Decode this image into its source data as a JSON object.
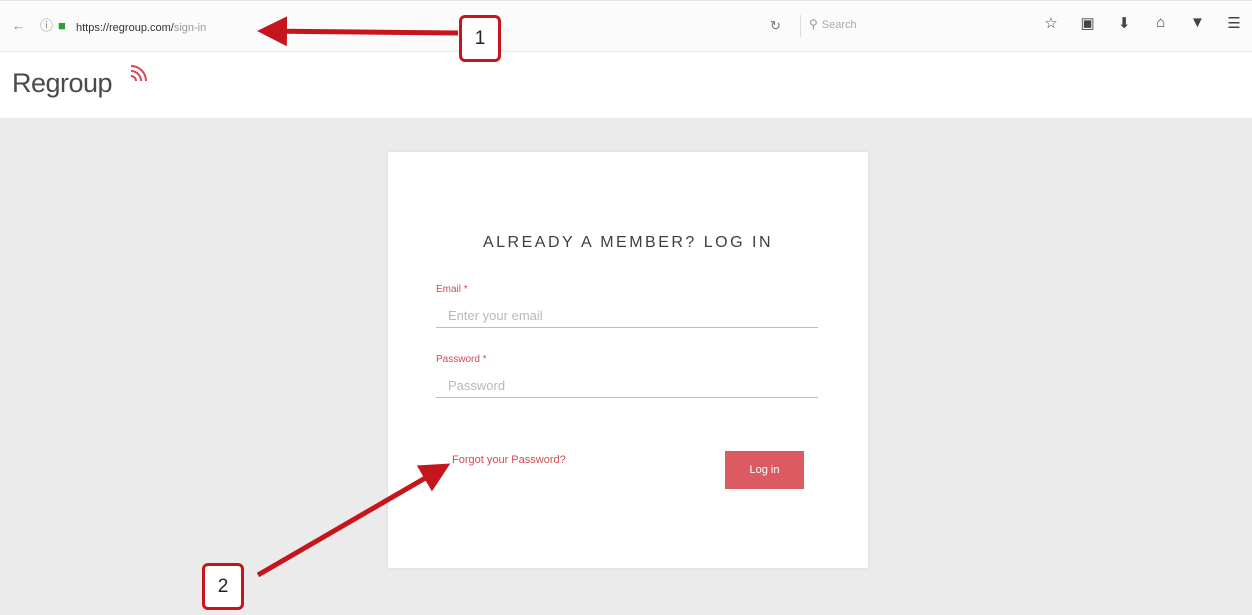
{
  "browser": {
    "url_host": "https://regroup.com/",
    "url_path": "sign-in",
    "search_placeholder": "Search"
  },
  "site": {
    "logo_text": "Regroup"
  },
  "login": {
    "title": "ALREADY A MEMBER? LOG IN",
    "email_label": "Email *",
    "email_placeholder": "Enter your email",
    "password_label": "Password *",
    "password_placeholder": "Password",
    "forgot_link": "Forgot your Password?",
    "login_button": "Log in"
  },
  "annotations": {
    "callout_1": "1",
    "callout_2": "2"
  },
  "colors": {
    "accent": "#dc5a62",
    "annotation": "#c4161c"
  }
}
